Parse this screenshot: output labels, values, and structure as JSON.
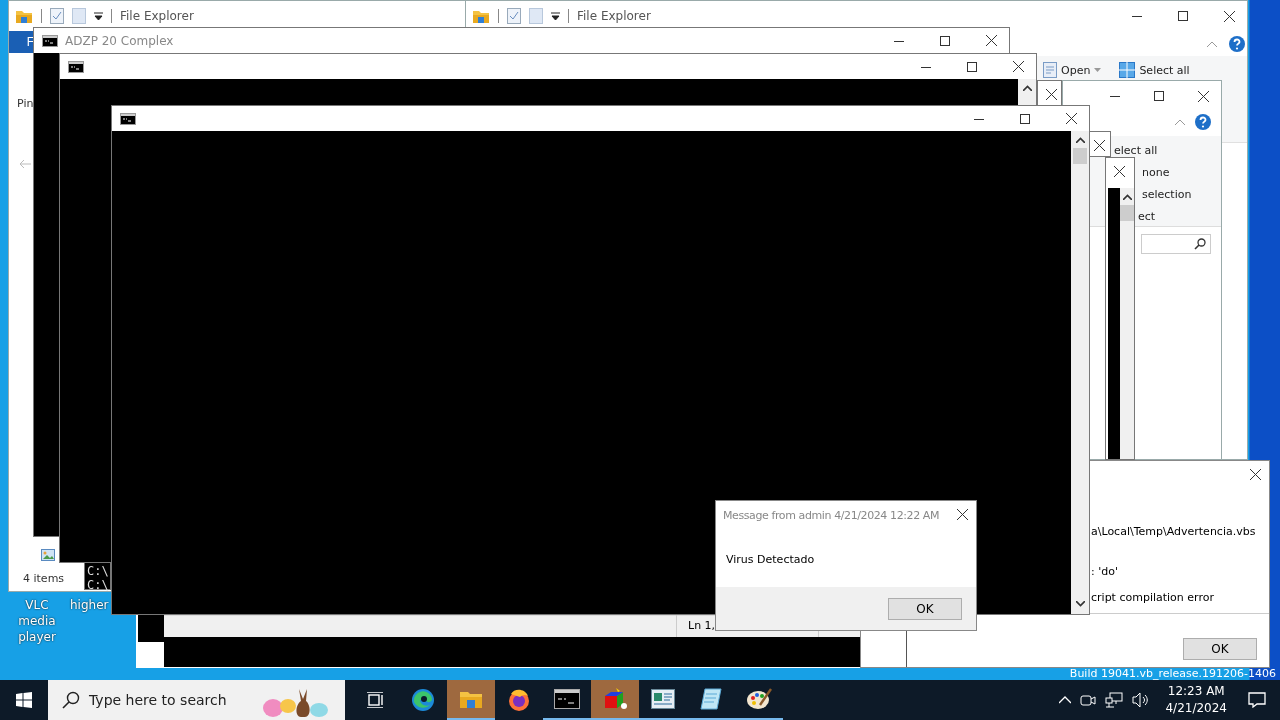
{
  "desktop_icons": [
    {
      "label": "VLC media player"
    },
    {
      "label": "higher"
    }
  ],
  "windows": [
    {
      "kind": "explorer",
      "title": "File Explorer",
      "ribbon_tab": "F",
      "nav_label": "Pin",
      "status": "4 items"
    },
    {
      "kind": "explorer",
      "title": "File Explorer",
      "ribbon_buttons": [
        "Open",
        "Select all"
      ]
    },
    {
      "kind": "explorer",
      "ribbon_buttons": [
        "elect all",
        "none",
        "selection",
        "ect"
      ]
    },
    {
      "kind": "blank"
    },
    {
      "kind": "blank"
    },
    {
      "kind": "console_small"
    },
    {
      "kind": "error",
      "lines": [
        "a\\Local\\Temp\\Advertencia.vbs",
        ": 'do'",
        "cript compilation error"
      ],
      "button": "OK"
    },
    {
      "kind": "notepad",
      "status": "Ln 1,"
    },
    {
      "kind": "console",
      "title": "ADZP 20 Complex"
    },
    {
      "kind": "console",
      "lines": [
        "C:\\",
        "C:\\"
      ]
    },
    {
      "kind": "console"
    },
    {
      "kind": "console"
    },
    {
      "kind": "message",
      "title": "Message from admin 4/21/2024 12:22 AM",
      "text": "Virus Detectado",
      "button": "OK"
    }
  ],
  "build_text": "Build 19041.vb_release.191206-1406",
  "taskbar": {
    "search_placeholder": "Type here to search",
    "items": [
      {
        "kind": "task_view"
      },
      {
        "kind": "edge",
        "running": false,
        "flashing": false
      },
      {
        "kind": "explorer",
        "running": true,
        "flashing": true
      },
      {
        "kind": "firefox",
        "running": false,
        "flashing": false
      },
      {
        "kind": "cmd",
        "running": true,
        "flashing": false
      },
      {
        "kind": "cube",
        "running": true,
        "flashing": true
      },
      {
        "kind": "window",
        "running": true,
        "flashing": false
      },
      {
        "kind": "notepad",
        "running": true,
        "flashing": false
      },
      {
        "kind": "paint",
        "running": true,
        "flashing": false
      }
    ],
    "time": "12:23 AM",
    "date": "4/21/2024"
  }
}
